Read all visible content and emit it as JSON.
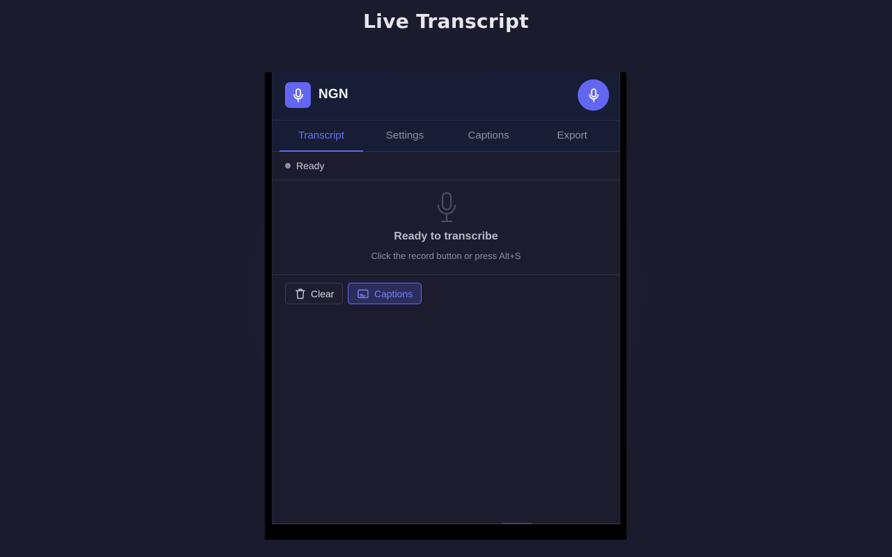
{
  "page": {
    "title": "Live Transcript"
  },
  "header": {
    "app_name": "NGN",
    "logo_icon": "microphone-icon",
    "record_icon": "microphone-icon",
    "accent_color": "#6366f1"
  },
  "tabs": [
    {
      "label": "Transcript",
      "active": true
    },
    {
      "label": "Settings",
      "active": false
    },
    {
      "label": "Captions",
      "active": false
    },
    {
      "label": "Export",
      "active": false
    }
  ],
  "status": {
    "text": "Ready",
    "dot_color": "#8b8fa0"
  },
  "empty_state": {
    "icon": "microphone-icon",
    "title": "Ready to transcribe",
    "hint": "Click the record button or press Alt+S"
  },
  "actions": {
    "clear": {
      "label": "Clear",
      "icon": "trash-icon"
    },
    "captions": {
      "label": "Captions",
      "icon": "captions-icon",
      "active": true
    }
  }
}
